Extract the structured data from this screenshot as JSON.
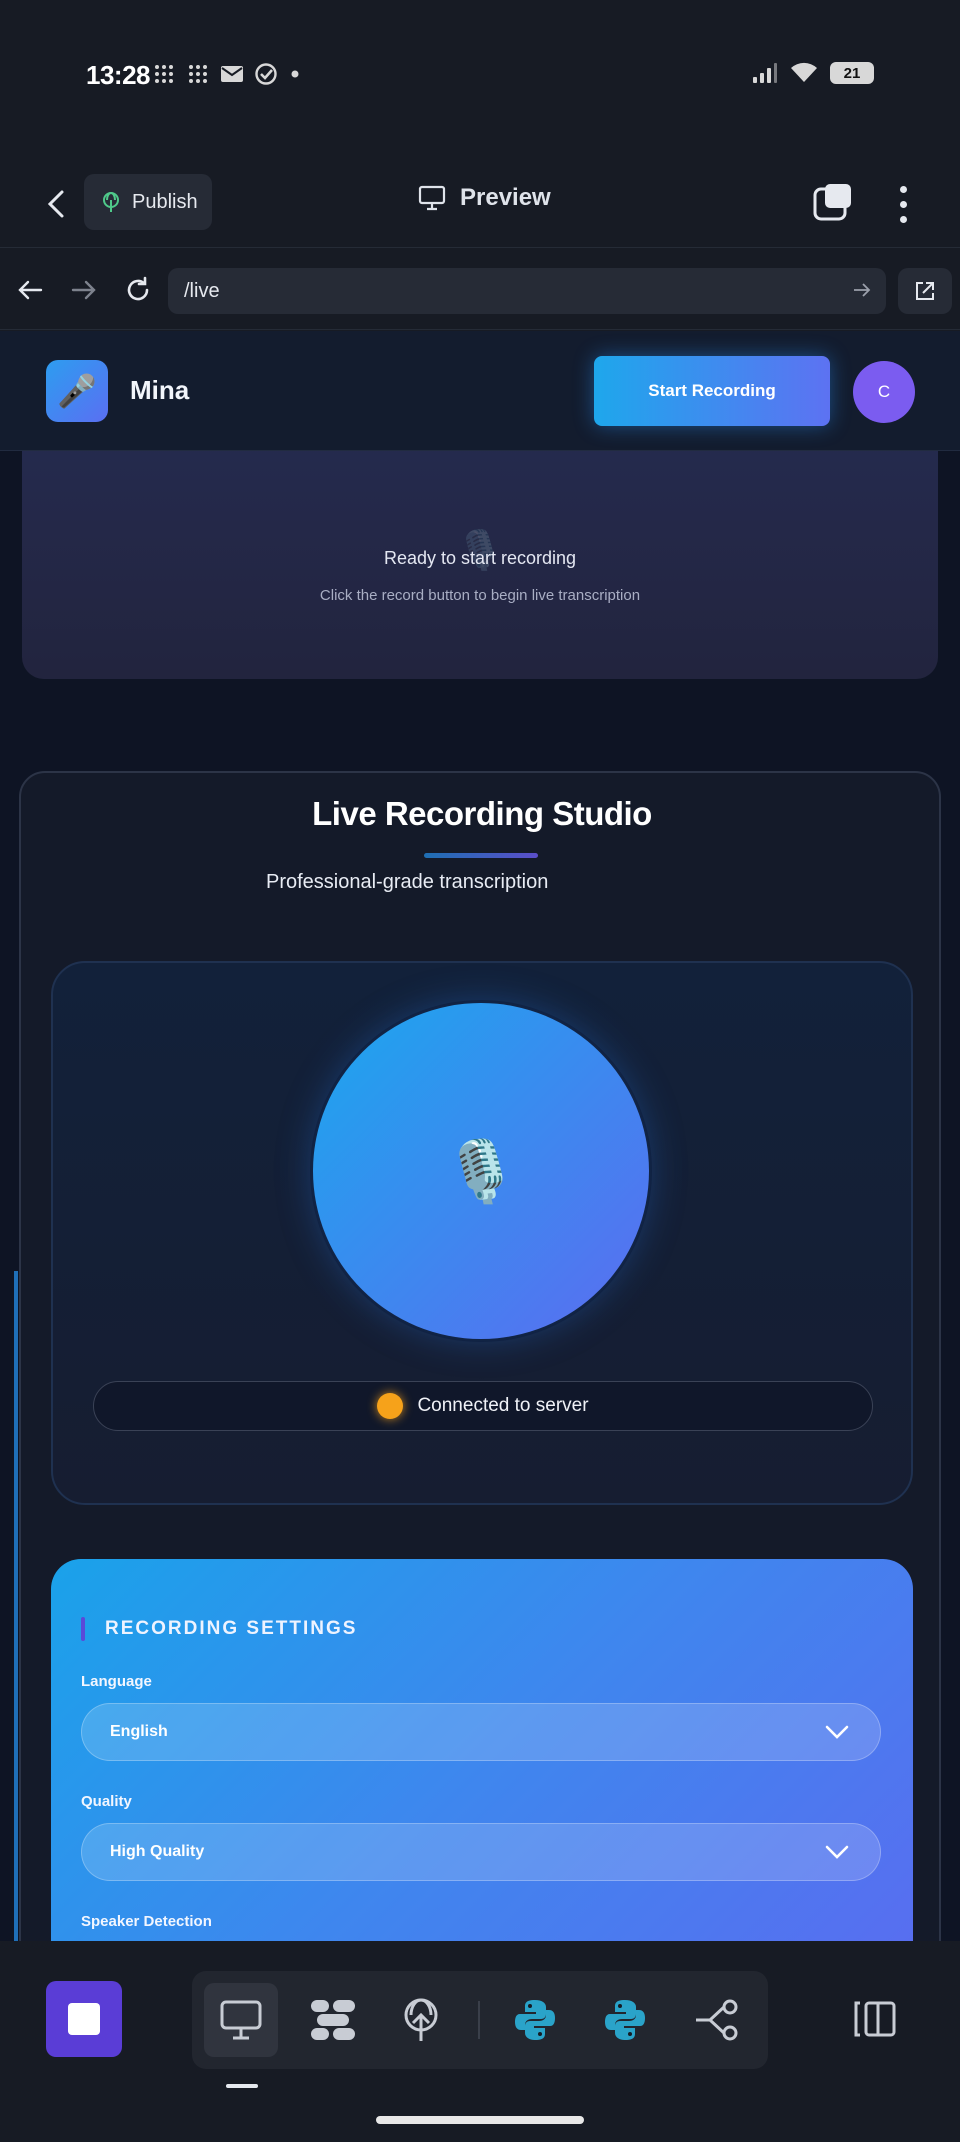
{
  "status_bar": {
    "time": "13:28",
    "battery": "21"
  },
  "toolbar": {
    "publish_label": "Publish",
    "preview_label": "Preview"
  },
  "url_bar": {
    "url": "/live"
  },
  "site_header": {
    "brand": "Mina",
    "start_button": "Start Recording",
    "avatar_initial": "C"
  },
  "transcript": {
    "title": "Ready to start recording",
    "subtitle": "Click the record button to begin live transcription"
  },
  "studio": {
    "title": "Live Recording Studio",
    "subtitle": "Professional-grade transcription",
    "connection_status": "Connected to server"
  },
  "settings": {
    "heading": "RECORDING SETTINGS",
    "language_label": "Language",
    "language_value": "English",
    "quality_label": "Quality",
    "quality_value": "High Quality",
    "speaker_label": "Speaker Detection"
  },
  "colors": {
    "accent_start": "#1ea7ec",
    "accent_end": "#5d72f2",
    "status_connected": "#f6a21a",
    "stop_button": "#5a3dd6"
  },
  "dock": {
    "icons": [
      "stop-icon",
      "monitor-icon",
      "workflow-icon",
      "deploy-icon",
      "python-icon",
      "python-icon",
      "share-icon",
      "side-panel-icon"
    ]
  }
}
